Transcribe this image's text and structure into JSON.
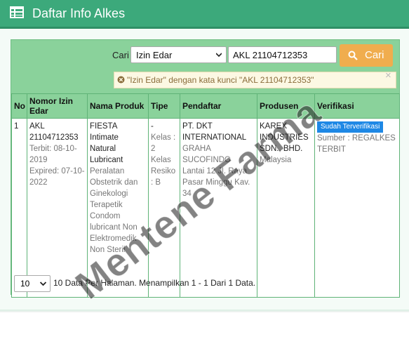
{
  "header": {
    "title": "Daftar Info Alkes"
  },
  "search": {
    "label": "Cari",
    "type_selected": "Izin Edar",
    "keyword": "AKL 21104712353",
    "button": "Cari"
  },
  "filter": {
    "text": "\"Izin Edar\" dengan kata kunci \"AKL 21104712353\"",
    "close": "×"
  },
  "table": {
    "headers": [
      "No",
      "Nomor Izin Edar",
      "Nama Produk",
      "Tipe",
      "Pendaftar",
      "Produsen",
      "Verifikasi"
    ],
    "rows": [
      {
        "no": "1",
        "izin": "AKL 21104712353",
        "terbit": "Terbit: 08-10-2019",
        "expired": "Expired: 07-10-2022",
        "produk": "FIESTA Intimate Natural Lubricant",
        "produk_desc": "Peralatan Obstetrik dan Ginekologi Terapetik Condom lubricant Non Elektromedik Non Steril",
        "tipe": "-",
        "tipe_desc": "Kelas : 2 Kelas Resiko : B",
        "pendaftar": "PT. DKT INTERNATIONAL",
        "pendaftar_addr": "GRAHA SUCOFINDO Lantai 12 Jl. Raya Pasar Minggu Kav. 34",
        "produsen": "KAREX INDUSTRIES SDN., BHD.",
        "produsen_country": "Malaysia",
        "verifikasi_badge": "Sudah Terverifikasi",
        "sumber": "Sumber : REGALKES TERBIT"
      }
    ]
  },
  "pagination": {
    "per_page": "10",
    "info": "10 Data Per Halaman. Menampilkan 1 - 1 Dari 1 Data."
  },
  "watermark": "Mentene Farma",
  "colors": {
    "header": "#3ca97b",
    "panel": "#8ad29b",
    "button": "#f0ad4e",
    "badge": "#1e88e5",
    "alert": "#fcf8e3"
  }
}
